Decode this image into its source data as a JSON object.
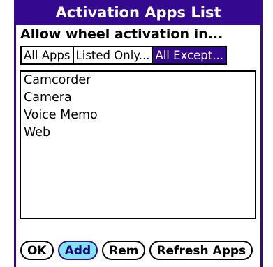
{
  "dialog": {
    "title": "Activation Apps List",
    "prompt": "Allow wheel activation in...",
    "colors": {
      "accent": "#35098f",
      "highlight": "#7fe6f0"
    }
  },
  "mode_selector": {
    "options": [
      "All Apps",
      "Listed Only...",
      "All Except..."
    ],
    "selected": "All Except..."
  },
  "apps_list": {
    "items": [
      "Camcorder",
      "Camera",
      "Voice Memo",
      "Web"
    ]
  },
  "buttons": {
    "ok": "OK",
    "add": "Add",
    "rem": "Rem",
    "refresh": "Refresh Apps"
  }
}
